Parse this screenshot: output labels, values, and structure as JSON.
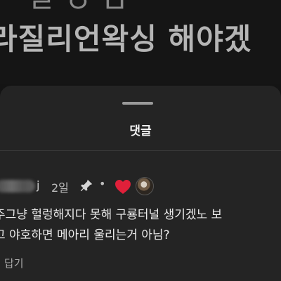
{
  "video": {
    "caption": "라질리언왁싱 해야겠",
    "caption_top_fragment": "ㄹ  ㅇ  ㅁ"
  },
  "comments_sheet": {
    "title": "댓글"
  },
  "comment": {
    "username_visible": "j",
    "time": "2일",
    "separator": "•",
    "icons": {
      "pin": "pin-icon",
      "heart": "heart-icon",
      "creator_avatar": "creator-avatar"
    },
    "heart_color": "#e0203a",
    "lines": [
      "주그냥 헐렁해지다 못해 구룡터널 생기겠노 보",
      "고 야호하면 메아리 울리는거 아님?"
    ],
    "reply_label": "답기"
  }
}
